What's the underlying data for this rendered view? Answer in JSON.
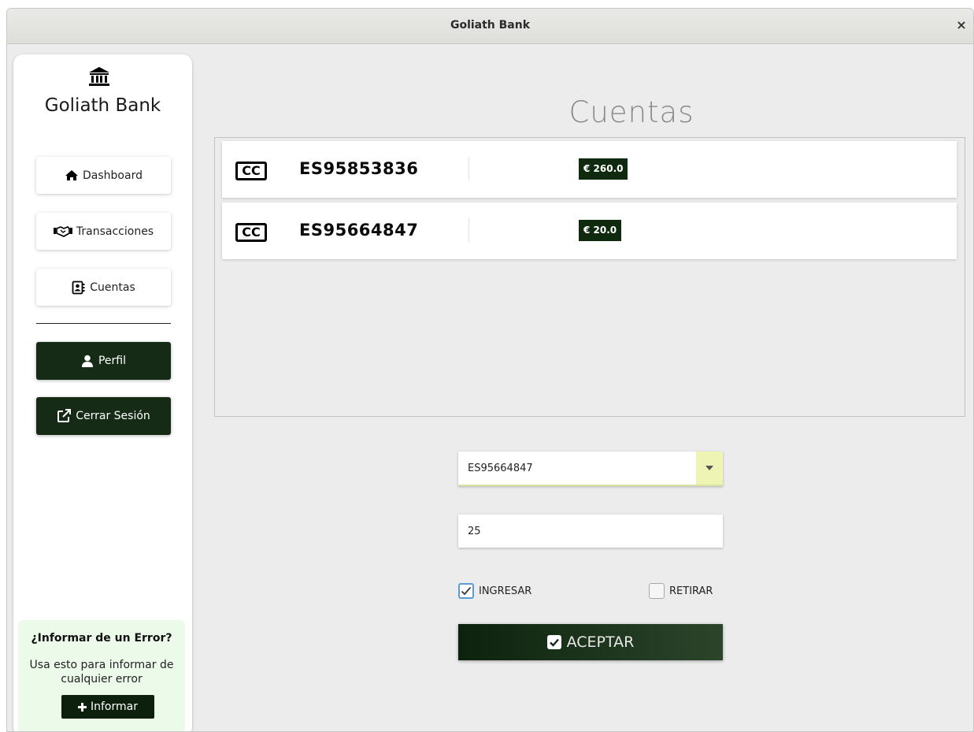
{
  "window": {
    "title": "Goliath Bank",
    "close_glyph": "×"
  },
  "sidebar": {
    "logo_icon": "bank-icon",
    "brand": "Goliath Bank",
    "nav": [
      {
        "label": "Dashboard",
        "icon": "home-icon"
      },
      {
        "label": "Transacciones",
        "icon": "handshake-icon"
      },
      {
        "label": "Cuentas",
        "icon": "address-book-icon"
      }
    ],
    "profile_label": "Perfil",
    "logout_label": "Cerrar Sesión",
    "report": {
      "title": "¿Informar de un Error?",
      "text": "Usa esto para informar de cualquier error",
      "button_label": "Informar"
    }
  },
  "main": {
    "title": "Cuentas",
    "accounts": [
      {
        "badge": "CC",
        "iban": "ES95853836",
        "balance": "€ 260.0"
      },
      {
        "badge": "CC",
        "iban": "ES95664847",
        "balance": "€ 20.0"
      }
    ],
    "form": {
      "selected_account": "ES95664847",
      "amount": "25",
      "deposit_label": "INGRESAR",
      "deposit_checked": true,
      "withdraw_label": "RETIRAR",
      "withdraw_checked": false,
      "accept_label": "ACEPTAR"
    }
  },
  "colors": {
    "dark_green": "#162b16",
    "accent_yellow": "#eef5b4",
    "report_bg": "#ecfbe9"
  }
}
